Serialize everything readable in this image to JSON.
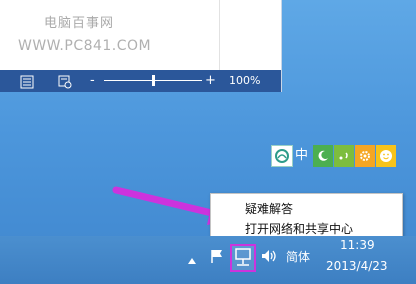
{
  "document": {
    "watermark_title": "电脑百事网",
    "watermark_url": "WWW.PC841.COM"
  },
  "statusbar": {
    "zoom_minus": "-",
    "zoom_plus": "+",
    "zoom_percent": "100%",
    "zoom_level": 0.5
  },
  "ime_toolbar": {
    "language": "中",
    "icons": [
      "ime-logo-icon",
      "moon-icon",
      "punctuation-icon",
      "gear-icon",
      "smile-icon"
    ]
  },
  "context_menu": {
    "items": [
      {
        "label": "疑难解答"
      },
      {
        "label": "打开网络和共享中心"
      }
    ]
  },
  "taskbar": {
    "ime_mode": "简体",
    "clock_time": "11:39",
    "clock_date": "2013/4/23"
  },
  "colors": {
    "accent": "#2b579a",
    "annotation": "#cc33dd",
    "desktop": "#4d97dc"
  }
}
